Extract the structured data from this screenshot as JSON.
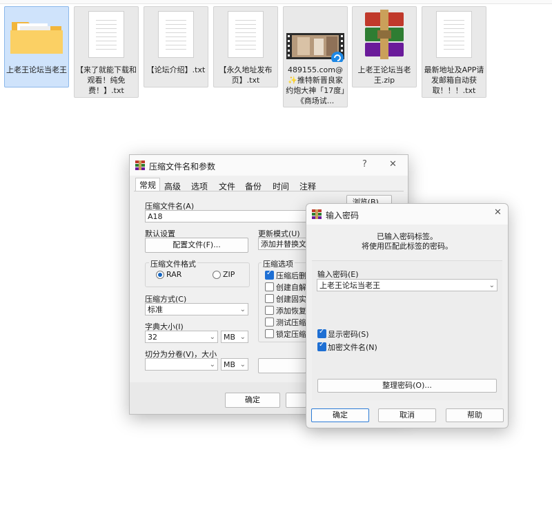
{
  "files": [
    {
      "caption": "上老王论坛当老王",
      "icon": "folder-icon"
    },
    {
      "caption": "【来了就能下载和观看！纯免费！】.txt",
      "icon": "text-file-icon"
    },
    {
      "caption": "【论坛介绍】.txt",
      "icon": "text-file-icon"
    },
    {
      "caption": "【永久地址发布页】.txt",
      "icon": "text-file-icon"
    },
    {
      "caption": "489155.com@✨推特新晋良家约炮大神「17度」《商场试...",
      "icon": "video-thumbnail-icon"
    },
    {
      "caption": "上老王论坛当老王.zip",
      "icon": "winrar-archive-icon"
    },
    {
      "caption": "最新地址及APP请发邮箱自动获取！！！.txt",
      "icon": "text-file-icon"
    }
  ],
  "archive_dialog": {
    "title": "压缩文件名和参数",
    "help": "?",
    "close": "✕",
    "tabs": [
      "常规",
      "高级",
      "选项",
      "文件",
      "备份",
      "时间",
      "注释"
    ],
    "archive_name_label": "压缩文件名(A)",
    "browse_button": "浏览(B)...",
    "archive_name_value": "A18",
    "default_settings_label": "默认设置",
    "profiles_button": "配置文件(F)...",
    "update_mode_label": "更新模式(U)",
    "update_mode_value": "添加并替换文件",
    "format_label": "压缩文件格式",
    "format_rar": "RAR",
    "format_zip": "ZIP",
    "options_label": "压缩选项",
    "options": [
      {
        "label": "压缩后删除源文件",
        "checked": true
      },
      {
        "label": "创建自解压格式压缩文件",
        "checked": false
      },
      {
        "label": "创建固实压缩文件",
        "checked": false
      },
      {
        "label": "添加恢复记录",
        "checked": false
      },
      {
        "label": "测试压缩的文件",
        "checked": false
      },
      {
        "label": "锁定压缩文件",
        "checked": false
      }
    ],
    "method_label": "压缩方式(C)",
    "method_value": "标准",
    "dict_label": "字典大小(I)",
    "dict_value": "32",
    "dict_unit": "MB",
    "split_label": "切分为分卷(V)，大小",
    "split_value": "",
    "split_unit": "MB",
    "ok_button": "确定"
  },
  "password_dialog": {
    "title": "输入密码",
    "close": "✕",
    "message_line1": "已输入密码标签。",
    "message_line2": "将使用匹配此标签的密码。",
    "enter_password_label": "输入密码(E)",
    "password_value": "上老王论坛当老王",
    "show_password_label": "显示密码(S)",
    "show_password_checked": true,
    "encrypt_names_label": "加密文件名(N)",
    "encrypt_names_checked": true,
    "organize_button": "整理密码(O)...",
    "ok_button": "确定",
    "cancel_button": "取消",
    "help_button": "帮助"
  },
  "colors": {
    "accent": "#1e6fd3",
    "selected_tile": "#cfe3fb",
    "dialog_bg": "#f0f0f0"
  }
}
